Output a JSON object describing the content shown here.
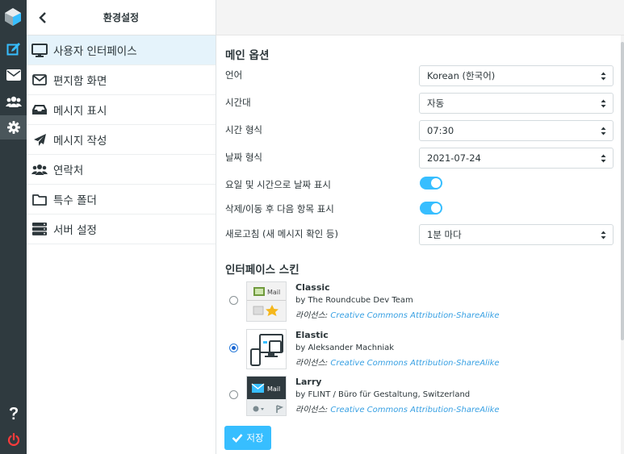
{
  "menu": {
    "title": "환경설정",
    "items": [
      {
        "label": "사용자 인터페이스"
      },
      {
        "label": "편지함 화면"
      },
      {
        "label": "메시지 표시"
      },
      {
        "label": "메시지 작성"
      },
      {
        "label": "연락처"
      },
      {
        "label": "특수 폴더"
      },
      {
        "label": "서버 설정"
      }
    ]
  },
  "main_options": {
    "title": "메인 옵션",
    "language": {
      "label": "언어",
      "value": "Korean (한국어)"
    },
    "timezone": {
      "label": "시간대",
      "value": "자동"
    },
    "time_format": {
      "label": "시간 형식",
      "value": "07:30"
    },
    "date_format": {
      "label": "날짜 형식",
      "value": "2021-07-24"
    },
    "pretty_date": {
      "label": "요일 및 시간으로 날짜 표시",
      "enabled": true
    },
    "display_next": {
      "label": "삭제/이동 후 다음 항목 표시",
      "enabled": true
    },
    "refresh": {
      "label": "새로고침 (새 메시지 확인 등)",
      "value": "1분 마다"
    }
  },
  "skins": {
    "title": "인터페이스 스킨",
    "items": [
      {
        "name": "Classic",
        "author": "by The Roundcube Dev Team",
        "license_prefix": "라이선스:",
        "license_link": "Creative Commons Attribution-ShareAlike",
        "selected": false,
        "thumb_text": "Mail"
      },
      {
        "name": "Elastic",
        "author": "by Aleksander Machniak",
        "license_prefix": "라이선스:",
        "license_link": "Creative Commons Attribution-ShareAlike",
        "selected": true
      },
      {
        "name": "Larry",
        "author": "by FLINT / Büro für Gestaltung, Switzerland",
        "license_prefix": "라이선스:",
        "license_link": "Creative Commons Attribution-ShareAlike",
        "selected": false,
        "thumb_text": "Mail"
      }
    ]
  },
  "save_label": "저장",
  "colors": {
    "accent": "#37beff",
    "rail": "#2f3a3f",
    "active_menu": "#e5f3fb",
    "link": "#37a0e3"
  },
  "rail_icons": [
    "roundcube-logo-icon",
    "compose-icon",
    "mail-icon",
    "contacts-icon",
    "settings-icon",
    "help-icon",
    "logout-icon"
  ]
}
